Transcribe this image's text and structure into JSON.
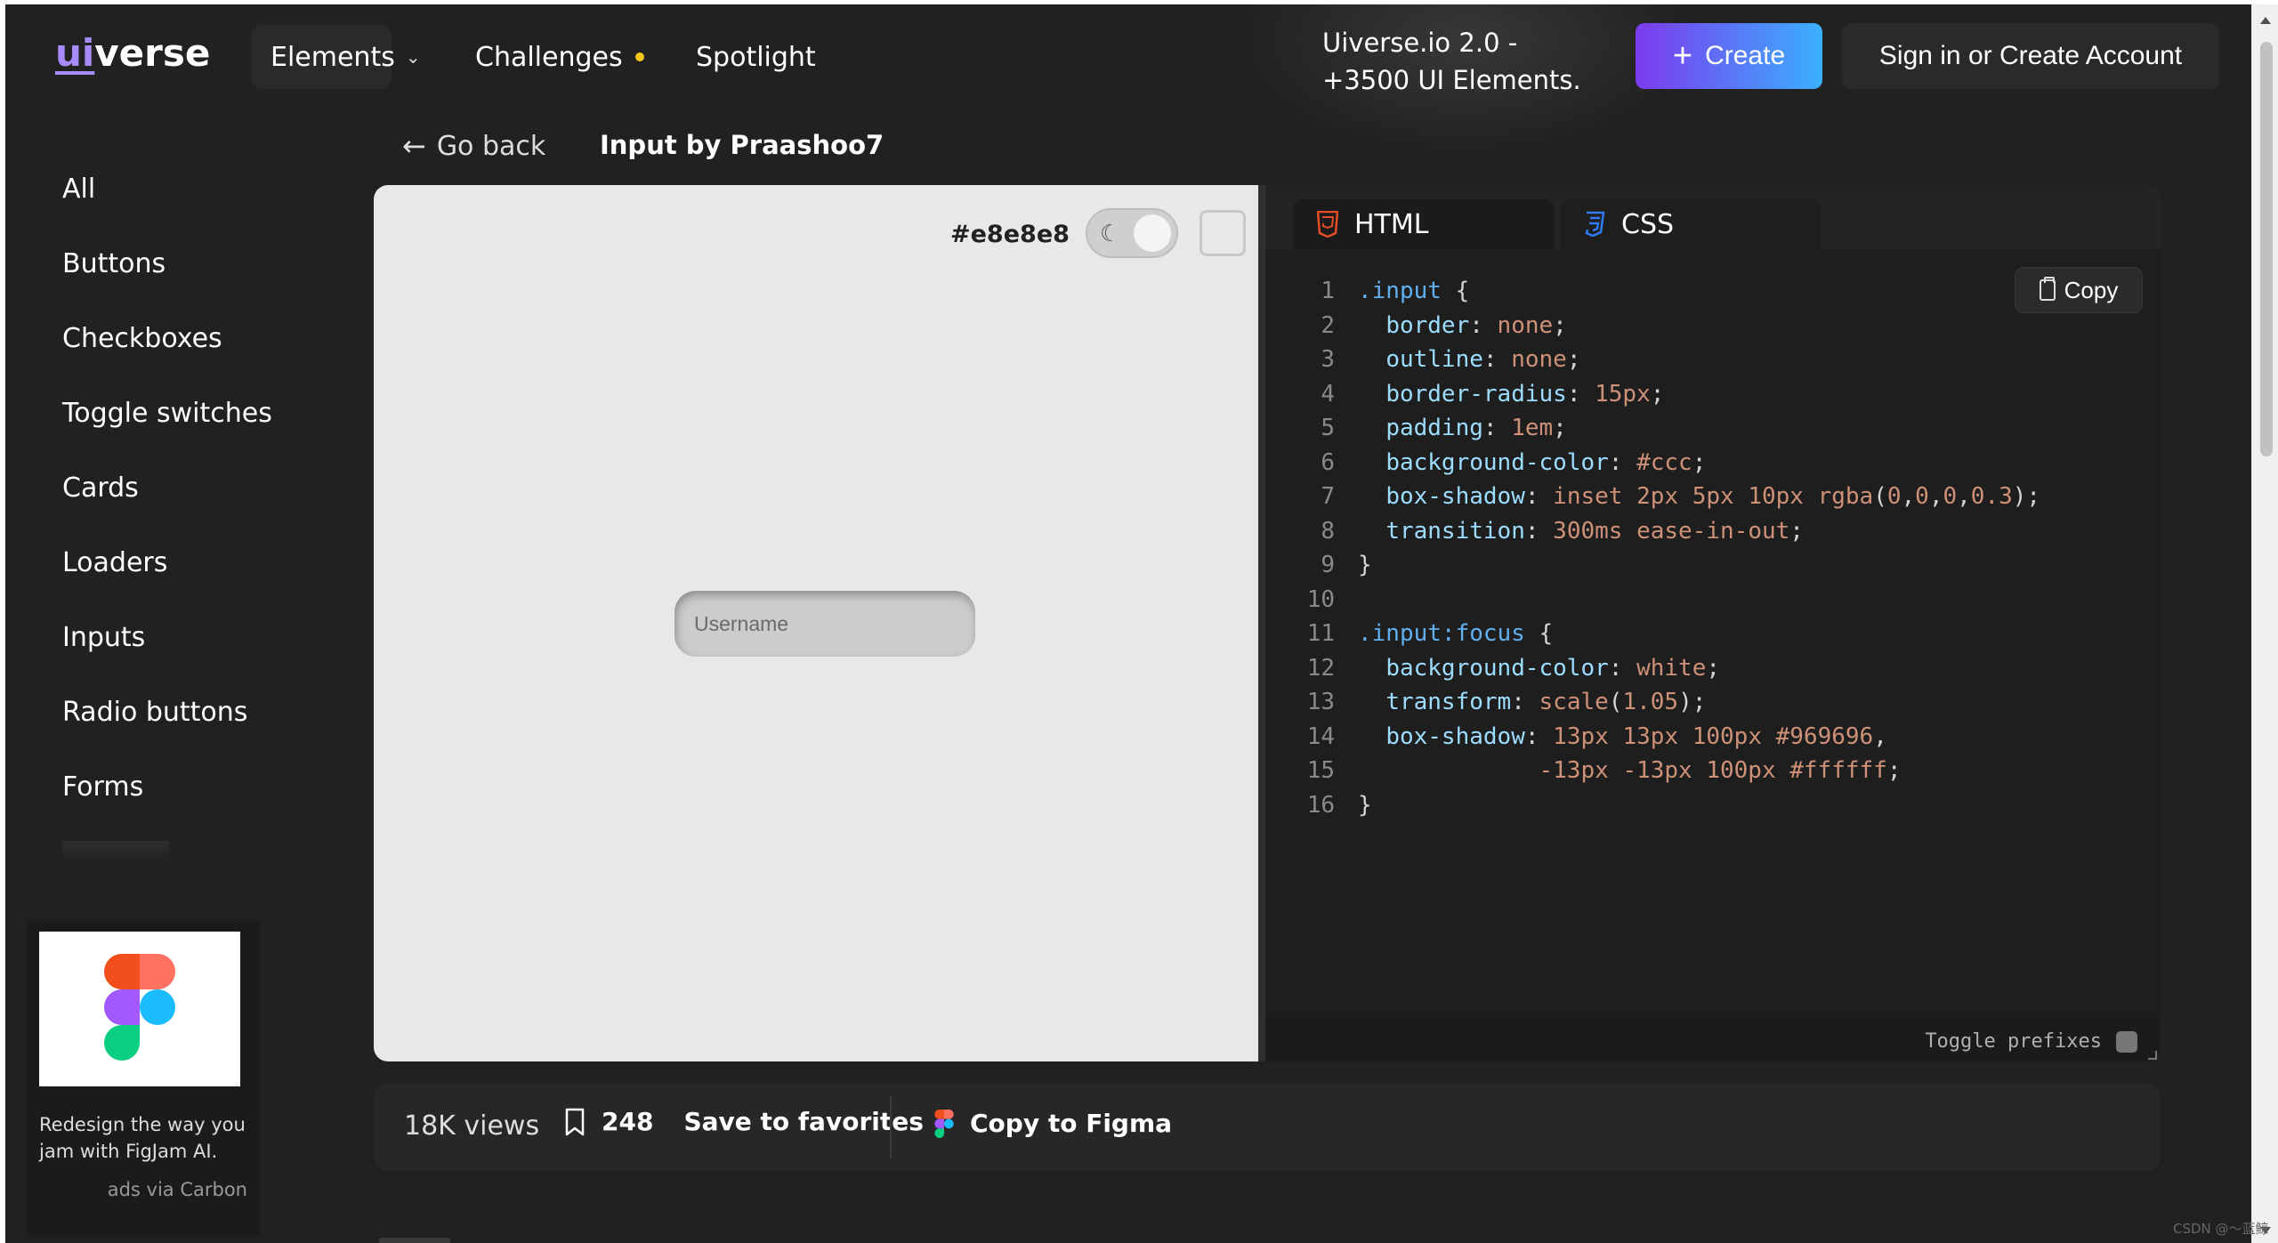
{
  "header": {
    "logo_prefix": "ui",
    "logo_suffix": "verse",
    "nav": {
      "elements": "Elements",
      "challenges": "Challenges",
      "spotlight": "Spotlight"
    },
    "promo_line1": "Uiverse.io 2.0 -",
    "promo_line2": "+3500 UI Elements.",
    "create_label": "Create",
    "signin_label": "Sign in or Create Account"
  },
  "sidebar": {
    "items": [
      {
        "label": "All"
      },
      {
        "label": "Buttons"
      },
      {
        "label": "Checkboxes"
      },
      {
        "label": "Toggle switches"
      },
      {
        "label": "Cards"
      },
      {
        "label": "Loaders"
      },
      {
        "label": "Inputs"
      },
      {
        "label": "Radio buttons"
      },
      {
        "label": "Forms"
      }
    ]
  },
  "ad": {
    "text": "Redesign the way you jam with FigJam AI.",
    "via": "ads via Carbon"
  },
  "breadcrumb": {
    "back_label": "Go back",
    "title": "Input by Praashoo7"
  },
  "preview": {
    "bg_color_label": "#e8e8e8",
    "input_placeholder": "Username"
  },
  "code": {
    "tabs": [
      {
        "label": "HTML",
        "icon": "html5-icon"
      },
      {
        "label": "CSS",
        "icon": "css3-icon"
      }
    ],
    "copy_label": "Copy",
    "toggle_prefixes_label": "Toggle prefixes",
    "lines": [
      {
        "n": "1",
        "tokens": [
          [
            "sel",
            ".input"
          ],
          [
            "pun",
            " {"
          ]
        ]
      },
      {
        "n": "2",
        "tokens": [
          [
            "pun",
            "  "
          ],
          [
            "prop",
            "border"
          ],
          [
            "pun",
            ": "
          ],
          [
            "val",
            "none"
          ],
          [
            "pun",
            ";"
          ]
        ]
      },
      {
        "n": "3",
        "tokens": [
          [
            "pun",
            "  "
          ],
          [
            "prop",
            "outline"
          ],
          [
            "pun",
            ": "
          ],
          [
            "val",
            "none"
          ],
          [
            "pun",
            ";"
          ]
        ]
      },
      {
        "n": "4",
        "tokens": [
          [
            "pun",
            "  "
          ],
          [
            "prop",
            "border-radius"
          ],
          [
            "pun",
            ": "
          ],
          [
            "num",
            "15px"
          ],
          [
            "pun",
            ";"
          ]
        ]
      },
      {
        "n": "5",
        "tokens": [
          [
            "pun",
            "  "
          ],
          [
            "prop",
            "padding"
          ],
          [
            "pun",
            ": "
          ],
          [
            "num",
            "1em"
          ],
          [
            "pun",
            ";"
          ]
        ]
      },
      {
        "n": "6",
        "tokens": [
          [
            "pun",
            "  "
          ],
          [
            "prop",
            "background-color"
          ],
          [
            "pun",
            ": "
          ],
          [
            "val",
            "#ccc"
          ],
          [
            "pun",
            ";"
          ]
        ]
      },
      {
        "n": "7",
        "tokens": [
          [
            "pun",
            "  "
          ],
          [
            "prop",
            "box-shadow"
          ],
          [
            "pun",
            ": "
          ],
          [
            "val",
            "inset 2px 5px 10px rgba"
          ],
          [
            "pun",
            "("
          ],
          [
            "num",
            "0"
          ],
          [
            "pun",
            ","
          ],
          [
            "num",
            "0"
          ],
          [
            "pun",
            ","
          ],
          [
            "num",
            "0"
          ],
          [
            "pun",
            ","
          ],
          [
            "num",
            "0.3"
          ],
          [
            "pun",
            ");"
          ]
        ]
      },
      {
        "n": "8",
        "tokens": [
          [
            "pun",
            "  "
          ],
          [
            "prop",
            "transition"
          ],
          [
            "pun",
            ": "
          ],
          [
            "val",
            "300ms ease-in-out"
          ],
          [
            "pun",
            ";"
          ]
        ]
      },
      {
        "n": "9",
        "tokens": [
          [
            "pun",
            "}"
          ]
        ]
      },
      {
        "n": "10",
        "tokens": [
          [
            "pun",
            ""
          ]
        ]
      },
      {
        "n": "11",
        "tokens": [
          [
            "sel",
            ".input:focus"
          ],
          [
            "pun",
            " {"
          ]
        ]
      },
      {
        "n": "12",
        "tokens": [
          [
            "pun",
            "  "
          ],
          [
            "prop",
            "background-color"
          ],
          [
            "pun",
            ": "
          ],
          [
            "val",
            "white"
          ],
          [
            "pun",
            ";"
          ]
        ]
      },
      {
        "n": "13",
        "tokens": [
          [
            "pun",
            "  "
          ],
          [
            "prop",
            "transform"
          ],
          [
            "pun",
            ": "
          ],
          [
            "val",
            "scale"
          ],
          [
            "pun",
            "("
          ],
          [
            "num",
            "1.05"
          ],
          [
            "pun",
            ");"
          ]
        ]
      },
      {
        "n": "14",
        "tokens": [
          [
            "pun",
            "  "
          ],
          [
            "prop",
            "box-shadow"
          ],
          [
            "pun",
            ": "
          ],
          [
            "val",
            "13px 13px 100px #969696"
          ],
          [
            "pun",
            ","
          ]
        ]
      },
      {
        "n": "15",
        "tokens": [
          [
            "pun",
            "             "
          ],
          [
            "val",
            "-13px -13px 100px #ffffff"
          ],
          [
            "pun",
            ";"
          ]
        ]
      },
      {
        "n": "16",
        "tokens": [
          [
            "pun",
            "}"
          ]
        ]
      }
    ]
  },
  "stats": {
    "views": "18K views",
    "favorites_count": "248",
    "save_label": "Save to favorites",
    "figma_label": "Copy to Figma"
  },
  "watermark": "CSDN @～蓝鲸",
  "colors": {
    "app_bg": "#212121",
    "accent_purple": "#7c3aed",
    "accent_blue": "#3ab0ff",
    "preview_bg": "#e8e8e8"
  }
}
